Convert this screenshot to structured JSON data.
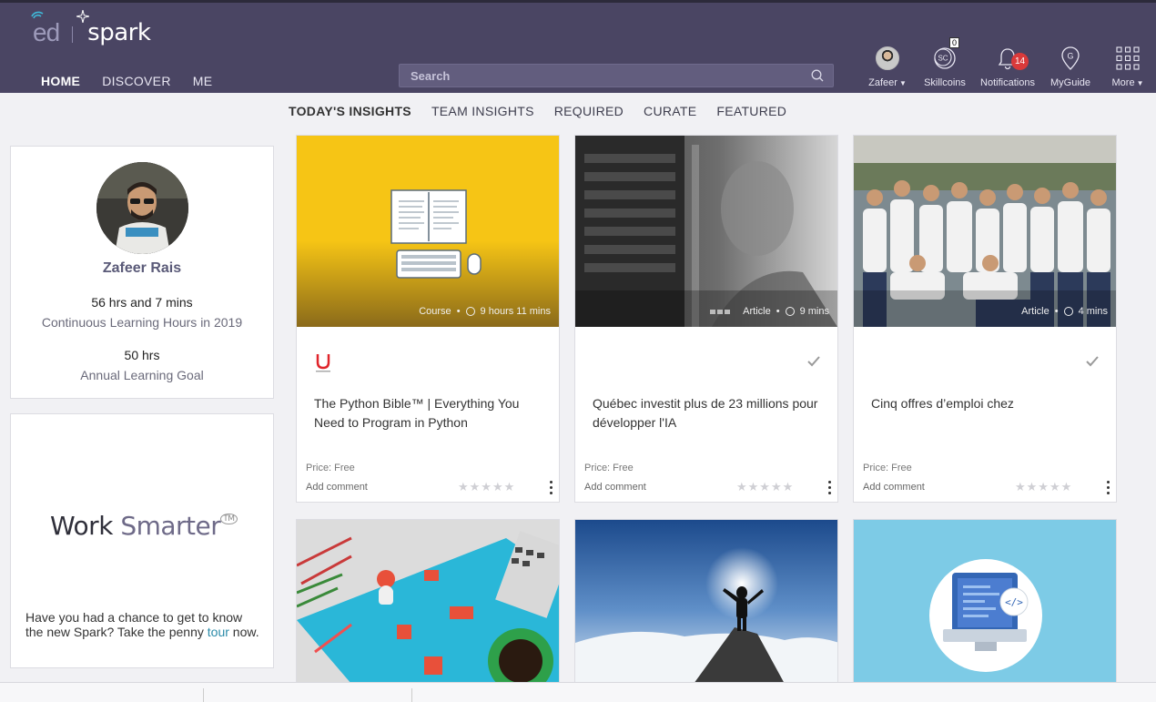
{
  "header": {
    "brand_ed": "ed",
    "brand_spark": "spark",
    "nav": [
      {
        "label": "HOME",
        "active": true
      },
      {
        "label": "DISCOVER",
        "active": false
      },
      {
        "label": "ME",
        "active": false
      }
    ],
    "search_placeholder": "Search",
    "tools": {
      "user_label": "Zafeer",
      "skillcoins_label": "Skillcoins",
      "skillcoins_count": "0",
      "skillcoins_icon_text": "SC",
      "notifications_label": "Notifications",
      "notifications_count": "14",
      "myguide_label": "MyGuide",
      "more_label": "More"
    }
  },
  "subnav": [
    {
      "label": "TODAY'S INSIGHTS",
      "active": true
    },
    {
      "label": "TEAM INSIGHTS",
      "active": false
    },
    {
      "label": "REQUIRED",
      "active": false
    },
    {
      "label": "CURATE",
      "active": false
    },
    {
      "label": "FEATURED",
      "active": false
    }
  ],
  "profile": {
    "name": "Zafeer Rais",
    "hours_value": "56 hrs and 7 mins",
    "hours_label": "Continuous Learning Hours in 2019",
    "goal_value": "50 hrs",
    "goal_label": "Annual Learning Goal"
  },
  "promo": {
    "title_dark": "Work ",
    "title_light": "Smarter",
    "tm": "TM",
    "text_before": "Have you had a chance to get to know the new Spark? Take the penny ",
    "link": "tour",
    "text_after": " now."
  },
  "cards": [
    {
      "type": "Course",
      "duration": "9 hours 11 mins",
      "title": "The Python Bible™ | Everything You Need to Program in Python",
      "price": "Price: Free",
      "comment": "Add comment",
      "provider": "Udemy"
    },
    {
      "type": "Article",
      "duration": "9 mins",
      "title": "Québec investit plus de 23 millions pour développer l'IA",
      "price": "Price: Free",
      "comment": "Add comment"
    },
    {
      "type": "Article",
      "duration": "4 mins",
      "title": "Cinq offres d’emploi chez",
      "price": "Price: Free",
      "comment": "Add comment"
    }
  ],
  "stars": "★★★★★",
  "colors": {
    "header_bg": "#4a4563",
    "accent_link": "#2a8aa8",
    "badge_red": "#d93a3a"
  }
}
